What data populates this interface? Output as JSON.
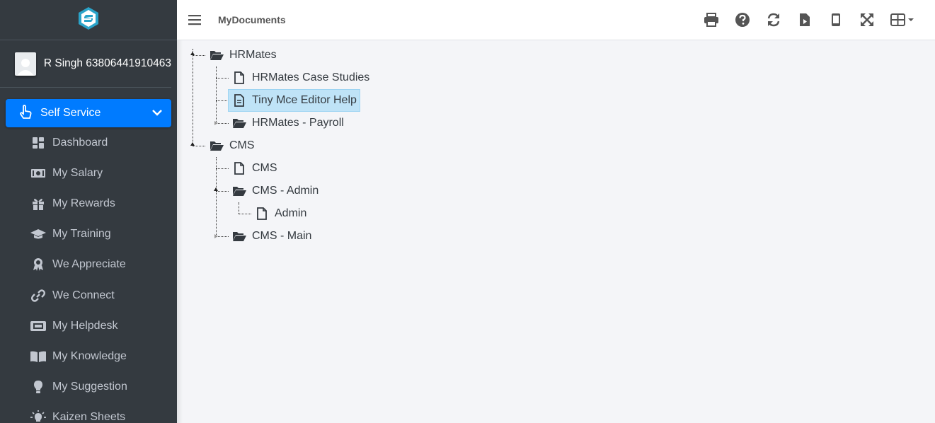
{
  "app": {
    "logo": "brand-logo-icon"
  },
  "user": {
    "name": "R Singh 63806441910463"
  },
  "sidebar": {
    "active": {
      "label": "Self Service",
      "icon": "hand-pointer-icon"
    },
    "items": [
      {
        "label": "Dashboard",
        "icon": "dashboard-icon"
      },
      {
        "label": "My Salary",
        "icon": "money-icon"
      },
      {
        "label": "My Rewards",
        "icon": "gift-icon"
      },
      {
        "label": "My Training",
        "icon": "graduation-cap-icon"
      },
      {
        "label": "We Appreciate",
        "icon": "award-icon"
      },
      {
        "label": "We Connect",
        "icon": "link-icon"
      },
      {
        "label": "My Helpdesk",
        "icon": "ticket-icon"
      },
      {
        "label": "My Knowledge",
        "icon": "book-icon"
      },
      {
        "label": "My Suggestion",
        "icon": "lightbulb-icon"
      },
      {
        "label": "Kaizen Sheets",
        "icon": "bulb-idea-icon"
      }
    ]
  },
  "header": {
    "title": "MyDocuments",
    "tools": [
      "print-icon",
      "help-icon",
      "refresh-icon",
      "file-video-icon",
      "mobile-icon",
      "expand-icon",
      "grid-menu-icon"
    ]
  },
  "tree": {
    "nodes": [
      {
        "label": "HRMates",
        "type": "folder"
      },
      {
        "label": "HRMates Case Studies",
        "type": "file"
      },
      {
        "label": "Tiny Mce Editor Help",
        "type": "file",
        "selected": true
      },
      {
        "label": "HRMates - Payroll",
        "type": "folder"
      },
      {
        "label": "CMS",
        "type": "folder"
      },
      {
        "label": "CMS",
        "type": "file"
      },
      {
        "label": "CMS - Admin",
        "type": "folder"
      },
      {
        "label": "Admin",
        "type": "file"
      },
      {
        "label": "CMS - Main",
        "type": "folder"
      }
    ]
  },
  "colors": {
    "sidebar_bg": "#343a40",
    "active_bg": "#007bff",
    "selected_bg": "#bfe3f7",
    "page_bg": "#f4f5f8"
  }
}
